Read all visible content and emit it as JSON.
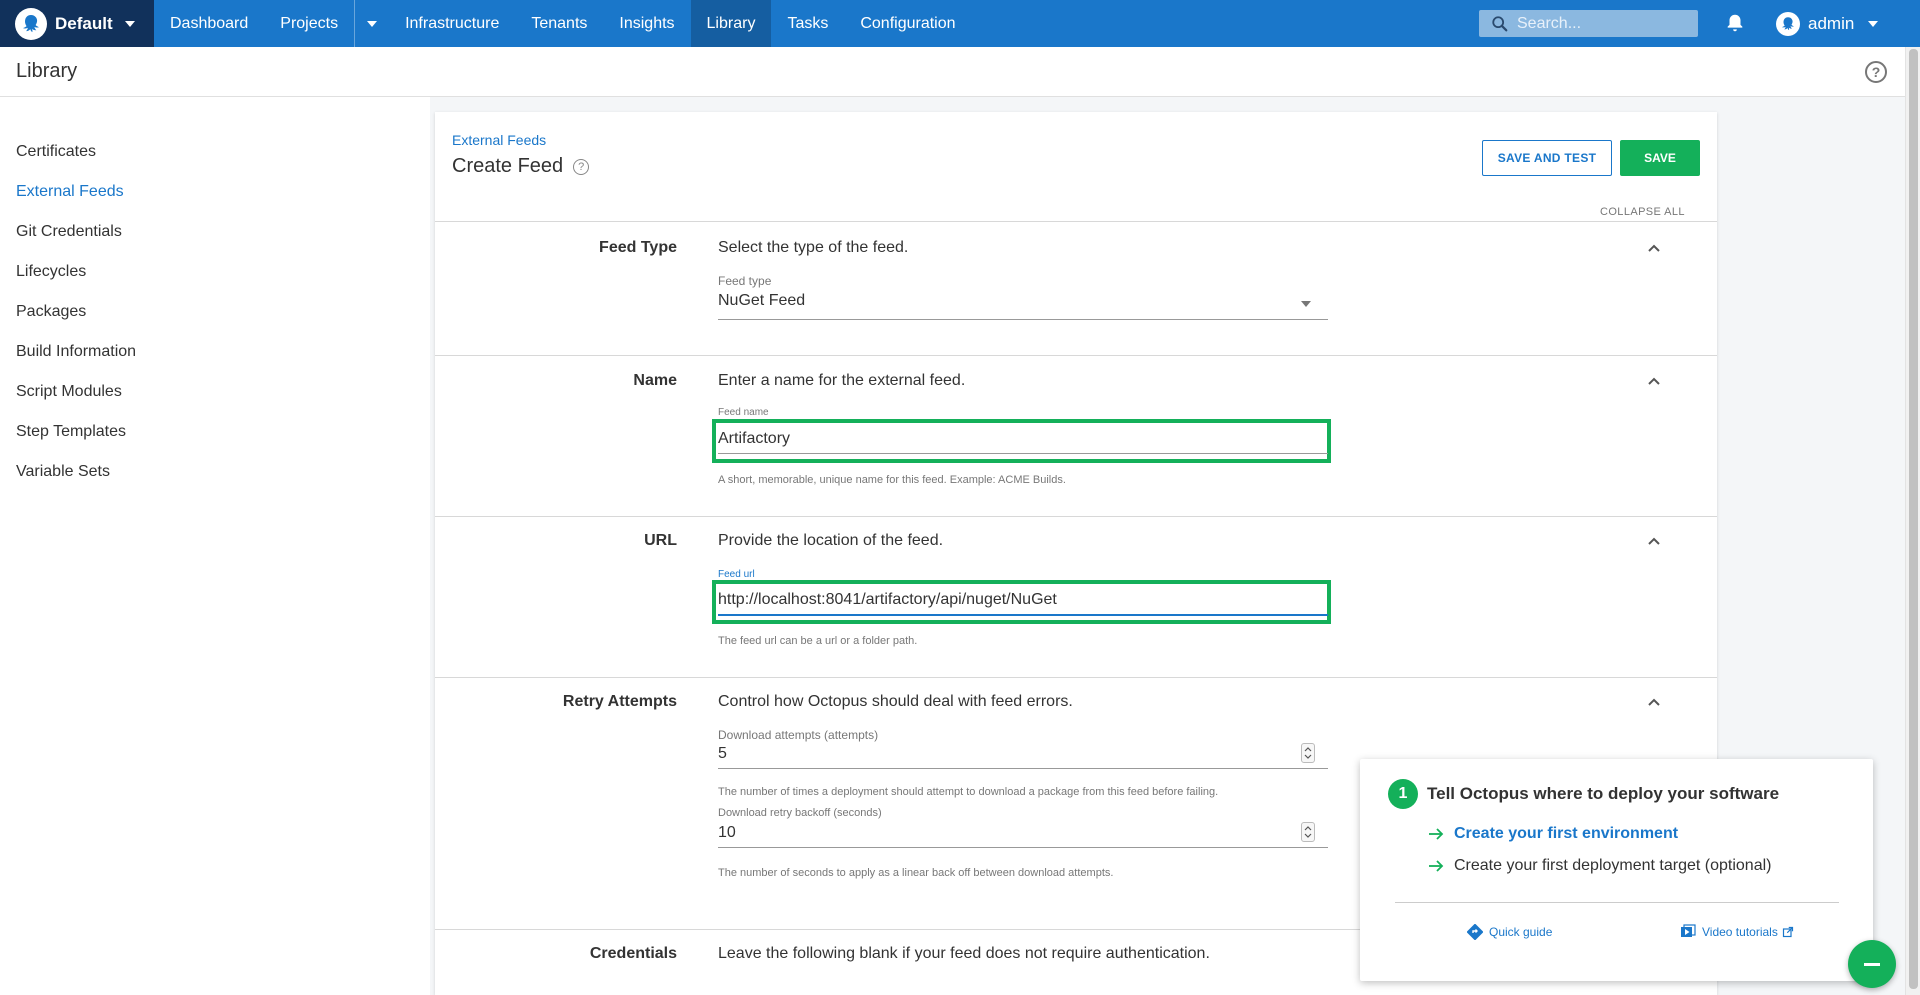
{
  "topnav": {
    "space": "Default",
    "items": [
      {
        "label": "Dashboard"
      },
      {
        "label": "Projects"
      },
      {
        "label": "Infrastructure"
      },
      {
        "label": "Tenants"
      },
      {
        "label": "Insights"
      },
      {
        "label": "Library"
      },
      {
        "label": "Tasks"
      },
      {
        "label": "Configuration"
      }
    ],
    "active": "Library",
    "search_placeholder": "Search...",
    "user": "admin"
  },
  "subheader": {
    "title": "Library"
  },
  "sidebar": {
    "items": [
      {
        "label": "Certificates"
      },
      {
        "label": "External Feeds"
      },
      {
        "label": "Git Credentials"
      },
      {
        "label": "Lifecycles"
      },
      {
        "label": "Packages"
      },
      {
        "label": "Build Information"
      },
      {
        "label": "Script Modules"
      },
      {
        "label": "Step Templates"
      },
      {
        "label": "Variable Sets"
      }
    ],
    "active": "External Feeds"
  },
  "form": {
    "breadcrumb": "External Feeds",
    "title": "Create Feed",
    "save_and_test_label": "SAVE AND TEST",
    "save_label": "SAVE",
    "collapse_all": "COLLAPSE ALL",
    "feed_type": {
      "label": "Feed Type",
      "description": "Select the type of the feed.",
      "field_label": "Feed type",
      "value": "NuGet Feed"
    },
    "name": {
      "label": "Name",
      "description": "Enter a name for the external feed.",
      "field_label": "Feed name",
      "value": "Artifactory",
      "hint": "A short, memorable, unique name for this feed. Example: ACME Builds."
    },
    "url": {
      "label": "URL",
      "description": "Provide the location of the feed.",
      "field_label": "Feed url",
      "value": "http://localhost:8041/artifactory/api/nuget/NuGet",
      "hint": "The feed url can be a url or a folder path."
    },
    "retry": {
      "label": "Retry Attempts",
      "description": "Control how Octopus should deal with feed errors.",
      "attempts_label": "Download attempts (attempts)",
      "attempts_value": "5",
      "attempts_hint": "The number of times a deployment should attempt to download a package from this feed before failing.",
      "backoff_label": "Download retry backoff (seconds)",
      "backoff_value": "10",
      "backoff_hint": "The number of seconds to apply as a linear back off between download attempts."
    },
    "credentials": {
      "label": "Credentials",
      "description": "Leave the following blank if your feed does not require authentication."
    }
  },
  "onboarding": {
    "step": "1",
    "title": "Tell Octopus where to deploy your software",
    "link_primary": "Create your first environment",
    "link_secondary": "Create your first deployment target (optional)",
    "quick_guide": "Quick guide",
    "video_tutorials": "Video tutorials"
  },
  "colors": {
    "nav_blue": "#1a77ca",
    "space_navy": "#11315b",
    "green": "#14b05a",
    "highlight": "#14b05a"
  }
}
